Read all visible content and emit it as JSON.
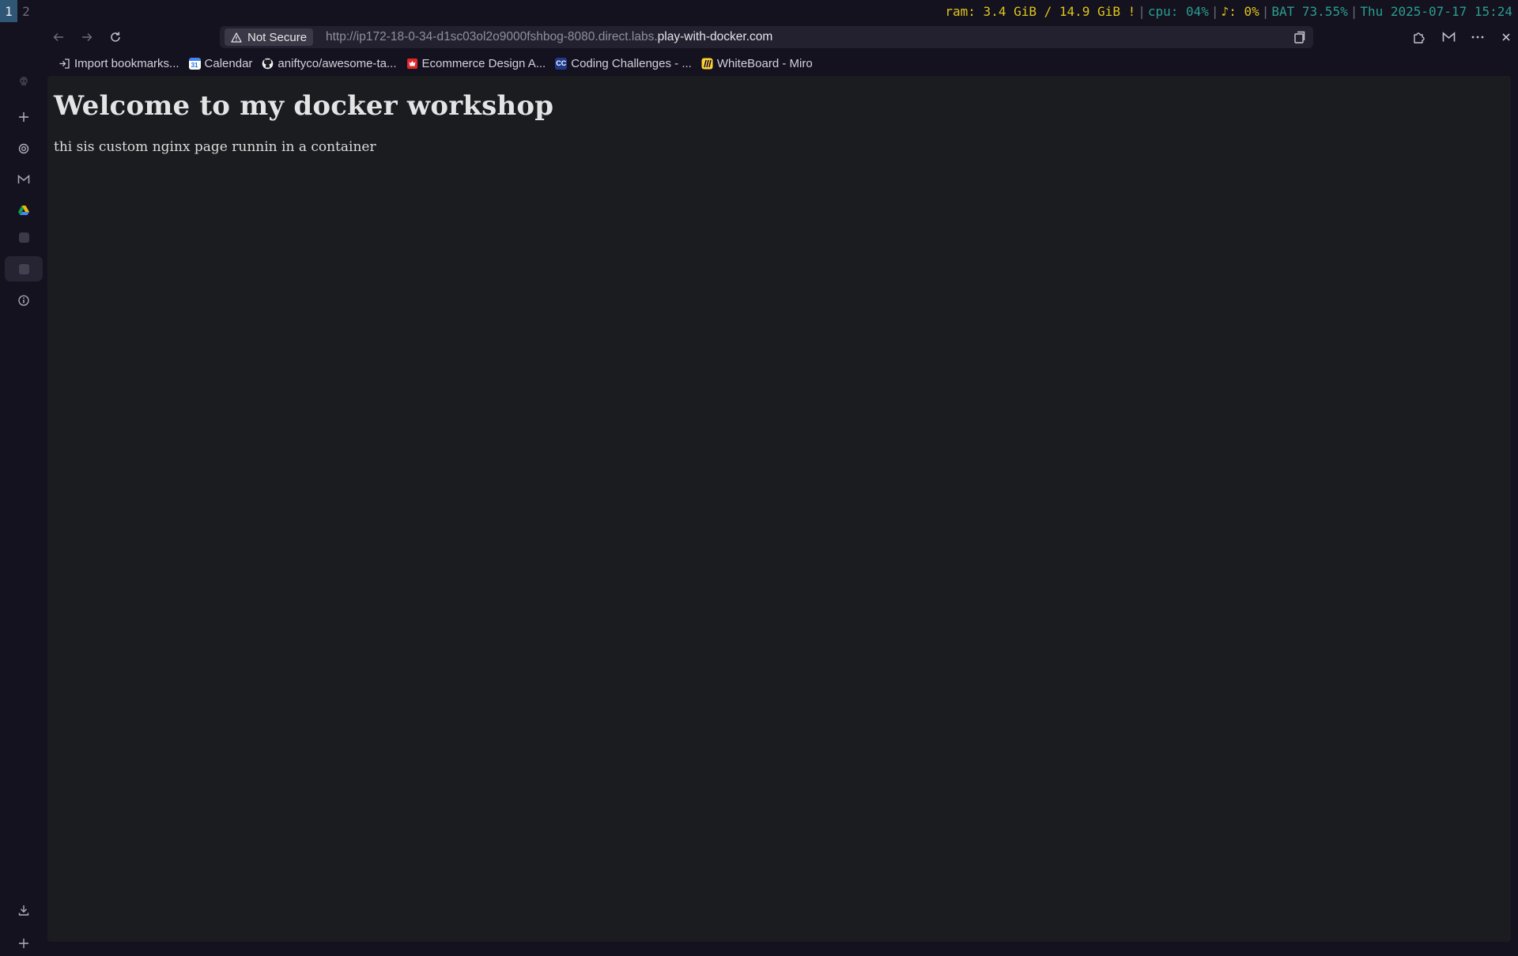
{
  "statusbar": {
    "workspaces": [
      "1",
      "2"
    ],
    "ram": "ram: 3.4 GiB / 14.9 GiB !",
    "cpu": "cpu: 04%",
    "volume": "♪: 0%",
    "battery": "BAT 73.55%",
    "clock": "Thu 2025-07-17 15:24"
  },
  "browser": {
    "security_label": "Not Secure",
    "url_prefix": "http://ip172-18-0-34-d1sc03ol2o9000fshbog-8080.direct.labs.",
    "url_host": "play-with-docker.com"
  },
  "bookmarks": [
    {
      "label": "Import bookmarks...",
      "icon": "import-icon"
    },
    {
      "label": "Calendar",
      "icon": "calendar-icon"
    },
    {
      "label": "aniftyco/awesome-ta...",
      "icon": "github-icon"
    },
    {
      "label": "Ecommerce Design A...",
      "icon": "ecommerce-icon"
    },
    {
      "label": "Coding Challenges - ...",
      "icon": "cc-icon"
    },
    {
      "label": "WhiteBoard - Miro",
      "icon": "miro-icon"
    }
  ],
  "page": {
    "heading": "Welcome to my docker workshop",
    "text": "thi sis custom nginx page runnin in a container"
  },
  "colors": {
    "ram": "#e0c41c",
    "cpu": "#2a9d90",
    "workspace_active": "#2f5675",
    "content_bg": "#1b1c1f"
  }
}
